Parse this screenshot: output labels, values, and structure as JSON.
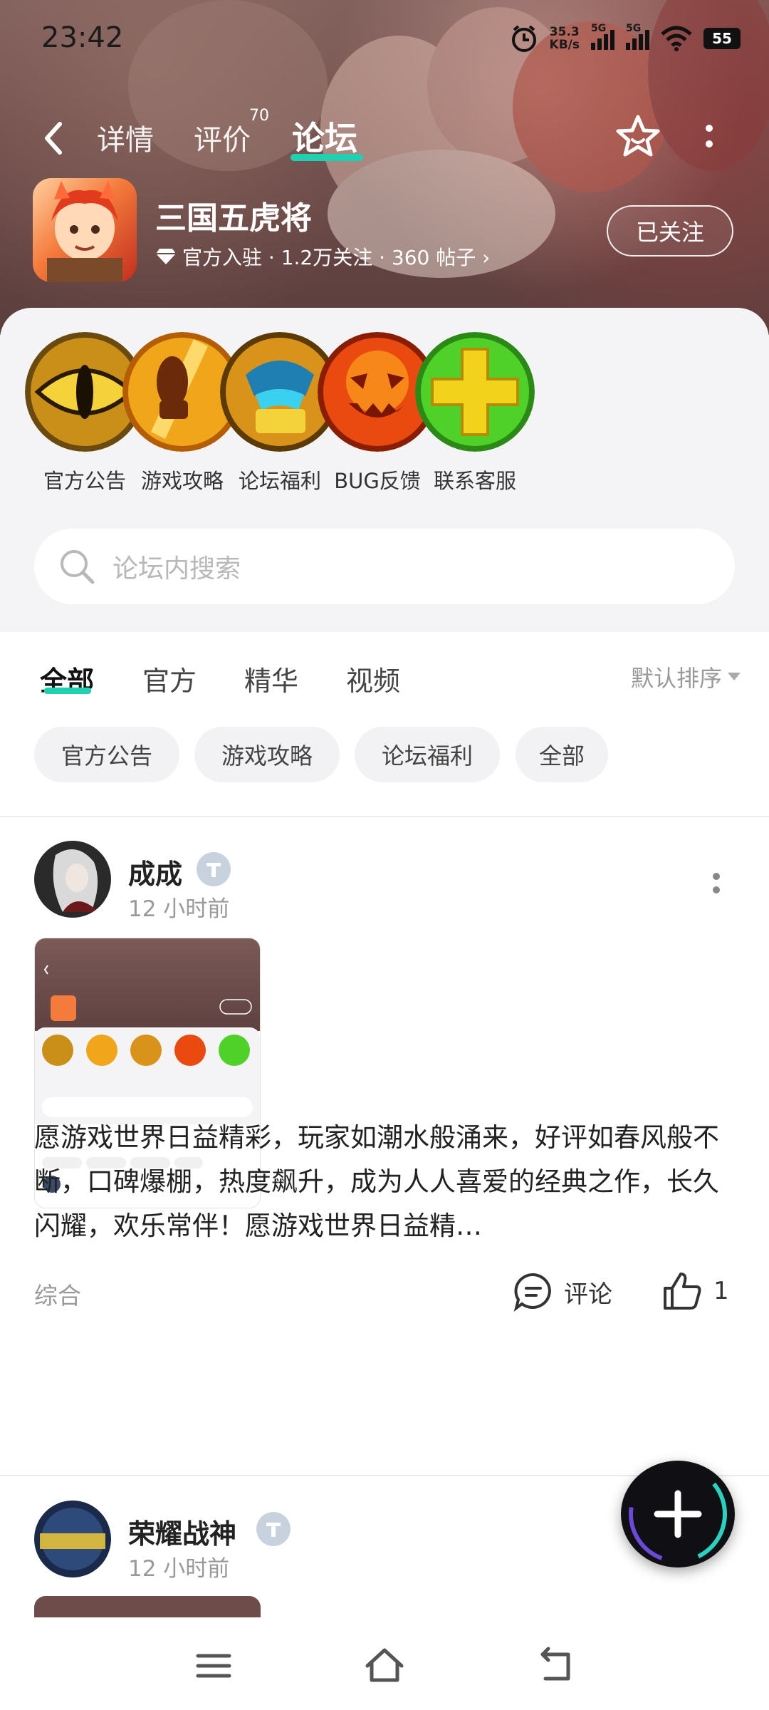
{
  "status": {
    "time": "23:42",
    "net_speed_value": "35.3",
    "net_speed_unit": "KB/s",
    "sim1": "5G",
    "sim2": "5G",
    "battery": "55"
  },
  "nav": {
    "tabs": [
      {
        "label": "详情"
      },
      {
        "label": "评价",
        "count": "70"
      },
      {
        "label": "论坛"
      }
    ]
  },
  "game": {
    "title": "三国五虎将",
    "meta": "官方入驻 · 1.2万关注 · 360 帖子 ›",
    "follow_label": "已关注"
  },
  "categories": [
    {
      "label": "官方公告"
    },
    {
      "label": "游戏攻略"
    },
    {
      "label": "论坛福利"
    },
    {
      "label": "BUG反馈"
    },
    {
      "label": "联系客服"
    }
  ],
  "search": {
    "placeholder": "论坛内搜索"
  },
  "filter_tabs": [
    {
      "label": "全部"
    },
    {
      "label": "官方"
    },
    {
      "label": "精华"
    },
    {
      "label": "视频"
    }
  ],
  "sort_label": "默认排序",
  "chips": [
    {
      "label": "官方公告"
    },
    {
      "label": "游戏攻略"
    },
    {
      "label": "论坛福利"
    },
    {
      "label": "全部"
    }
  ],
  "posts": [
    {
      "user": "成成",
      "time": "12 小时前",
      "text": "愿游戏世界日益精彩，玩家如潮水般涌来，好评如春风般不断，口碑爆棚，热度飙升，成为人人喜爱的经典之作，长久闪耀，欢乐常伴！愿游戏世界日益精…",
      "tag": "综合",
      "comment_label": "评论",
      "like_count": "1"
    },
    {
      "user": "荣耀战神",
      "time": "12 小时前"
    }
  ],
  "colors": {
    "accent": "#1fd1b0",
    "hero_bg": "#6e4c4a",
    "sheet_bg": "#f4f4f6"
  },
  "icons": {
    "back": "chevron-left-icon",
    "favorite": "star-icon",
    "more": "more-vertical-icon",
    "search": "search-icon",
    "comment": "comment-icon",
    "like": "thumbs-up-icon",
    "fab": "plus-icon",
    "nav_menu": "menu-icon",
    "nav_home": "home-icon",
    "nav_back": "back-icon"
  }
}
